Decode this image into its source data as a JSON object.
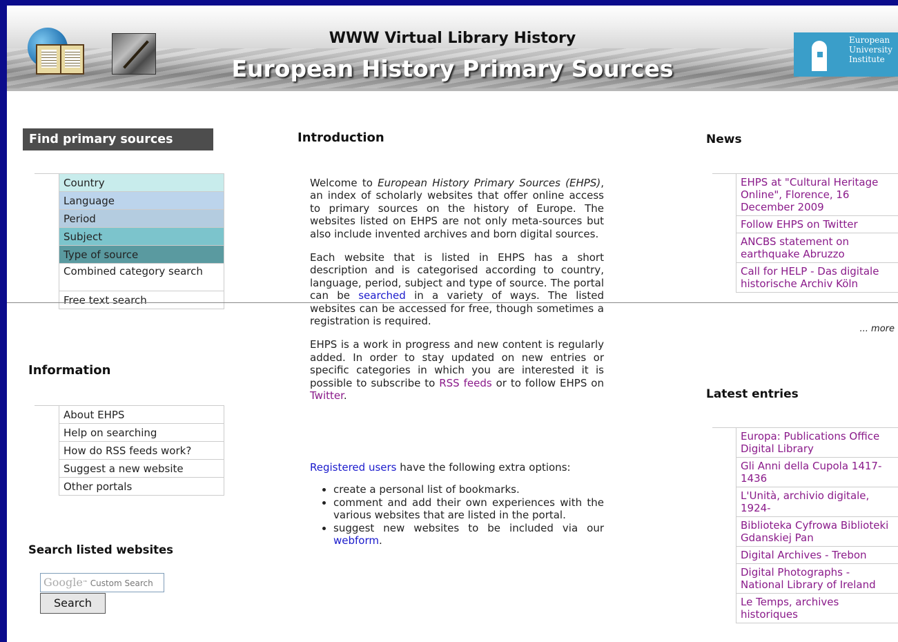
{
  "header": {
    "title_line1": "WWW Virtual Library History",
    "title_line2": "European History Primary Sources",
    "eui_logo_lines": [
      "European",
      "University",
      "Institute"
    ]
  },
  "find": {
    "title": "Find primary sources",
    "items": [
      {
        "label": "Country",
        "color": "#c8ecec"
      },
      {
        "label": "Language",
        "color": "#bcd4ec"
      },
      {
        "label": "Period",
        "color": "#b4cce0"
      },
      {
        "label": "Subject",
        "color": "#7cc4cc"
      },
      {
        "label": "Type of source",
        "color": "#5a9aa0"
      },
      {
        "label": "Combined category search"
      },
      {
        "label": "Free text search"
      }
    ]
  },
  "information": {
    "title": "Information",
    "items": [
      "About EHPS",
      "Help on searching",
      "How do RSS feeds work?",
      "Suggest a new website",
      "Other portals"
    ]
  },
  "search": {
    "title": "Search listed websites",
    "google_brand": "Google",
    "placeholder": "Custom Search",
    "button": "Search"
  },
  "intro": {
    "title": "Introduction",
    "p1_a": "Welcome to ",
    "p1_em": "European History Primary Sources (EHPS)",
    "p1_b": ", an index of scholarly websites that offer online access to primary sources on the history of Europe. The websites listed on EHPS are not only meta-sources but also include invented archives and born digital sources.",
    "p2_a": "Each website that is listed in EHPS has a short description and is categorised according to country, language, period, subject and type of source. The portal can be ",
    "p2_link": "searched",
    "p2_b": " in a variety of ways. The listed websites can be accessed for free, though sometimes a registration is required.",
    "p3_a": "EHPS is a work in progress and new content is regularly added. In order to stay updated on new entries or specific categories in which you are interested it is possible to subscribe to ",
    "p3_link1": "RSS feeds",
    "p3_b": " or to follow EHPS on ",
    "p3_link2": "Twitter",
    "p3_c": ".",
    "p4_link": "Registered users",
    "p4_b": " have the following extra options:",
    "bullet1": "create a personal list of bookmarks.",
    "bullet2": "comment and add their own experiences with the various websites that are listed in the portal.",
    "bullet3_a": "suggest new websites to be included via our ",
    "bullet3_link": "webform",
    "bullet3_b": "."
  },
  "news": {
    "title": "News",
    "items": [
      "EHPS at \"Cultural Heritage Online\", Florence, 16 December 2009",
      "Follow EHPS on Twitter",
      "ANCBS statement on earthquake Abruzzo",
      "Call for HELP - Das digitale historische Archiv Köln"
    ],
    "more": "... more"
  },
  "latest": {
    "title": "Latest entries",
    "items": [
      "Europa: Publications Office Digital Library",
      "Gli Anni della Cupola 1417-1436",
      "L'Unità, archivio digitale, 1924-",
      "Biblioteka Cyfrowa Biblioteki Gdanskiej Pan",
      "Digital Archives - Trebon",
      "Digital Photographs - National Library of Ireland",
      "Le Temps, archives historiques"
    ]
  }
}
